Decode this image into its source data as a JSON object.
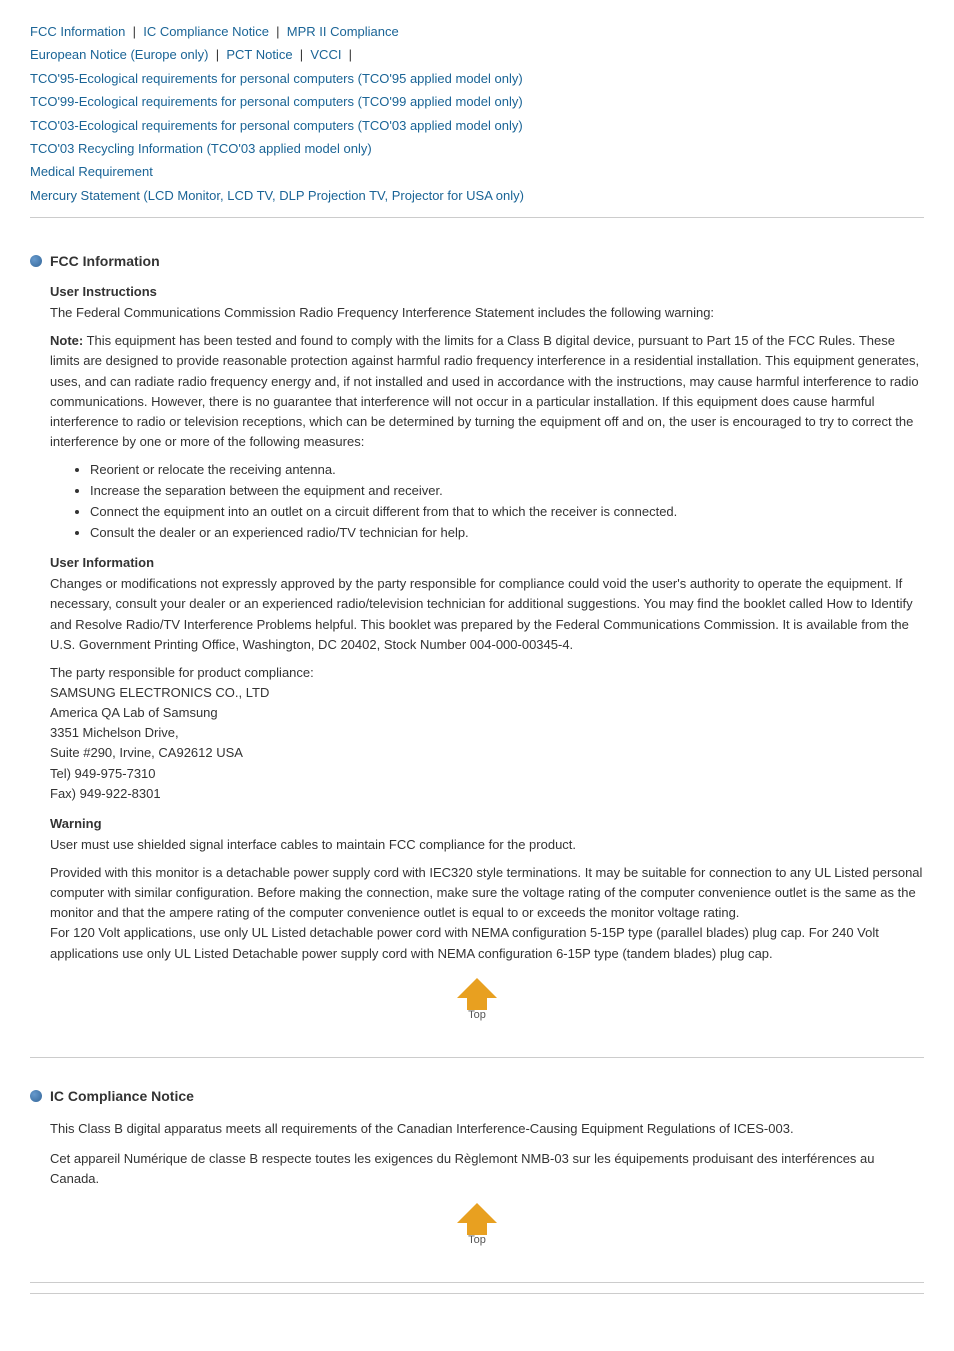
{
  "nav": {
    "row1": [
      {
        "label": "FCC Information",
        "href": "#fcc"
      },
      {
        "label": "IC Compliance Notice",
        "href": "#ic"
      },
      {
        "label": "MPR II Compliance",
        "href": "#mpr"
      }
    ],
    "row2": [
      {
        "label": "European Notice (Europe only)",
        "href": "#eu"
      },
      {
        "label": "PCT Notice",
        "href": "#pct"
      },
      {
        "label": "VCCI",
        "href": "#vcci"
      }
    ],
    "row3": [
      {
        "label": "TCO'95-Ecological requirements for personal computers (TCO'95 applied model only)",
        "href": "#tco95"
      }
    ],
    "row4": [
      {
        "label": "TCO'99-Ecological requirements for personal computers (TCO'99 applied model only)",
        "href": "#tco99"
      }
    ],
    "row5": [
      {
        "label": "TCO'03-Ecological requirements for personal computers (TCO'03 applied model only)",
        "href": "#tco03"
      }
    ],
    "row6": [
      {
        "label": "TCO'03 Recycling Information (TCO'03 applied model only)",
        "href": "#tco03r"
      }
    ],
    "row7": [
      {
        "label": "Medical Requirement",
        "href": "#med"
      }
    ],
    "row8": [
      {
        "label": "Mercury Statement (LCD Monitor, LCD TV, DLP Projection TV, Projector for USA only)",
        "href": "#mercury"
      }
    ]
  },
  "sections": {
    "fcc": {
      "title": "FCC Information",
      "subsections": {
        "user_instructions": {
          "title": "User Instructions",
          "intro": "The Federal Communications Commission Radio Frequency Interference Statement includes the following warning:",
          "note_bold": "Note:",
          "note_text": " This equipment has been tested and found to comply with the limits for a Class B digital device, pursuant to Part 15 of the FCC Rules. These limits are designed to provide reasonable protection against harmful radio frequency interference in a residential installation. This equipment generates, uses, and can radiate radio frequency energy and, if not installed and used in accordance with the instructions, may cause harmful interference to radio communications. However, there is no guarantee that interference will not occur in a particular installation. If this equipment does cause harmful interference to radio or television receptions, which can be determined by turning the equipment off and on, the user is encouraged to try to correct the interference by one or more of the following measures:",
          "bullets": [
            "Reorient or relocate the receiving antenna.",
            "Increase the separation between the equipment and receiver.",
            "Connect the equipment into an outlet on a circuit different from that to which the receiver is connected.",
            "Consult the dealer or an experienced radio/TV technician for help."
          ]
        },
        "user_information": {
          "title": "User Information",
          "para1": "Changes or modifications not expressly approved by the party responsible for compliance could void the user's authority to operate the equipment. If necessary, consult your dealer or an experienced radio/television technician for additional suggestions. You may find the booklet called How to Identify and Resolve Radio/TV Interference Problems helpful. This booklet was prepared by the Federal Communications Commission. It is available from the U.S. Government Printing Office, Washington, DC 20402, Stock Number 004-000-00345-4.",
          "para2": "The party responsible for product compliance:\nSAMSUNG ELECTRONICS CO., LTD\nAmerica QA Lab of Samsung\n3351 Michelson Drive,\nSuite #290, Irvine, CA92612 USA\nTel) 949-975-7310\nFax) 949-922-8301"
        },
        "warning": {
          "title": "Warning",
          "para1": "User must use shielded signal interface cables to maintain FCC compliance for the product.",
          "para2": "Provided with this monitor is a detachable power supply cord with IEC320 style terminations. It may be suitable for connection to any UL Listed personal computer with similar configuration. Before making the connection, make sure the voltage rating of the computer convenience outlet is the same as the monitor and that the ampere rating of the computer convenience outlet is equal to or exceeds the monitor voltage rating.\nFor 120 Volt applications, use only UL Listed detachable power cord with NEMA configuration 5-15P type (parallel blades) plug cap. For 240 Volt applications use only UL Listed Detachable power supply cord with NEMA configuration 6-15P type (tandem blades) plug cap."
        }
      }
    },
    "ic": {
      "title": "IC Compliance Notice",
      "para1": "This Class B digital apparatus meets all requirements of the Canadian Interference-Causing Equipment Regulations of ICES-003.",
      "para2": "Cet appareil Numérique de classe B respecte toutes les exigences du Règlemont NMB-03 sur les équipements produisant des interférences au Canada."
    }
  },
  "top_button_label": "Top"
}
